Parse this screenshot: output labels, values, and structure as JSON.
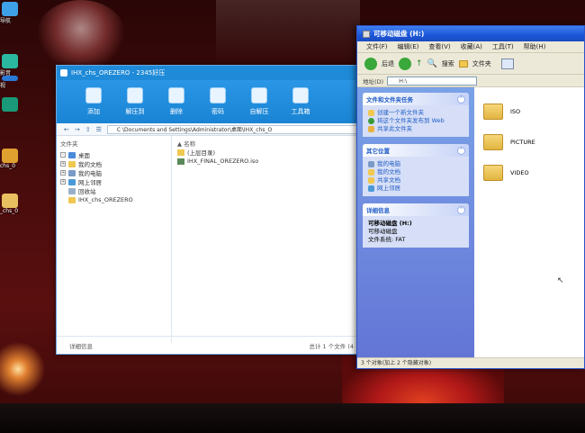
{
  "desktop": {
    "icons": [
      {
        "label": "导航",
        "color": "#3ea0e6"
      },
      {
        "label": "影音",
        "color": "#2ab8a0"
      },
      {
        "label": "视",
        "color": "#2a7ad8"
      },
      {
        "label": "chs_0",
        "color": "#e0a030"
      },
      {
        "label": "_chs_0",
        "color": "#e8c060"
      }
    ]
  },
  "zip": {
    "title": "IHX_chs_OREZERO - 2345好压",
    "toolbar": [
      {
        "label": "添加",
        "icon": "add-icon"
      },
      {
        "label": "解压到",
        "icon": "extract-icon"
      },
      {
        "label": "删除",
        "icon": "delete-icon"
      },
      {
        "label": "密码",
        "icon": "lock-icon"
      },
      {
        "label": "自解压",
        "icon": "sfx-icon"
      },
      {
        "label": "工具箱",
        "icon": "toolbox-icon"
      }
    ],
    "path": "C \\Documents and Settings\\Administrator\\桌面\\IHX_chs_O",
    "tree_header": "文件夹",
    "tree": [
      {
        "label": "桌面",
        "expand": "-",
        "color": "#4a8ad8"
      },
      {
        "label": "我的文档",
        "expand": "+",
        "color": "#f0c850"
      },
      {
        "label": "我的电脑",
        "expand": "+",
        "color": "#7a9ac8"
      },
      {
        "label": "网上邻居",
        "expand": "+",
        "color": "#4a9ad8"
      },
      {
        "label": "回收站",
        "expand": "",
        "color": "#9ab0c8"
      },
      {
        "label": "IHX_chs_OREZERO",
        "expand": "",
        "color": "#f0c850"
      }
    ],
    "list_header": "名称",
    "list": [
      {
        "label": "(上层目录)",
        "color": "#f0c850"
      },
      {
        "label": "IHX_FINAL_OREZERO.iso",
        "color": "#5a8a5a"
      }
    ],
    "detail_label": "详细信息",
    "status": "总计 1 个文件 (4"
  },
  "explorer": {
    "title": "可移动磁盘 (H:)",
    "menu": [
      "文件(F)",
      "编辑(E)",
      "查看(V)",
      "收藏(A)",
      "工具(T)",
      "帮助(H)"
    ],
    "toolbar": {
      "back": "后退",
      "search": "搜索",
      "folders": "文件夹"
    },
    "address_label": "地址(D)",
    "address_value": "H:\\",
    "tasks_panel": {
      "title": "文件和文件夹任务",
      "items": [
        {
          "label": "创建一个新文件夹",
          "color": "#f0c850"
        },
        {
          "label": "将这个文件夹发布到 Web",
          "color": "#3a9a3a"
        },
        {
          "label": "共享此文件夹",
          "color": "#e8b040"
        }
      ]
    },
    "places_panel": {
      "title": "其它位置",
      "items": [
        {
          "label": "我的电脑",
          "color": "#7a9ac8"
        },
        {
          "label": "我的文档",
          "color": "#f0c850"
        },
        {
          "label": "共享文档",
          "color": "#f0c850"
        },
        {
          "label": "网上邻居",
          "color": "#4a9ad8"
        }
      ]
    },
    "details_panel": {
      "title": "详细信息",
      "name": "可移动磁盘 (H:)",
      "type": "可移动磁盘",
      "fs": "文件系统: FAT"
    },
    "folders": [
      "ISO",
      "PICTURE",
      "VIDEO"
    ],
    "status": "3 个对象(加上 2 个隐藏对象)"
  }
}
